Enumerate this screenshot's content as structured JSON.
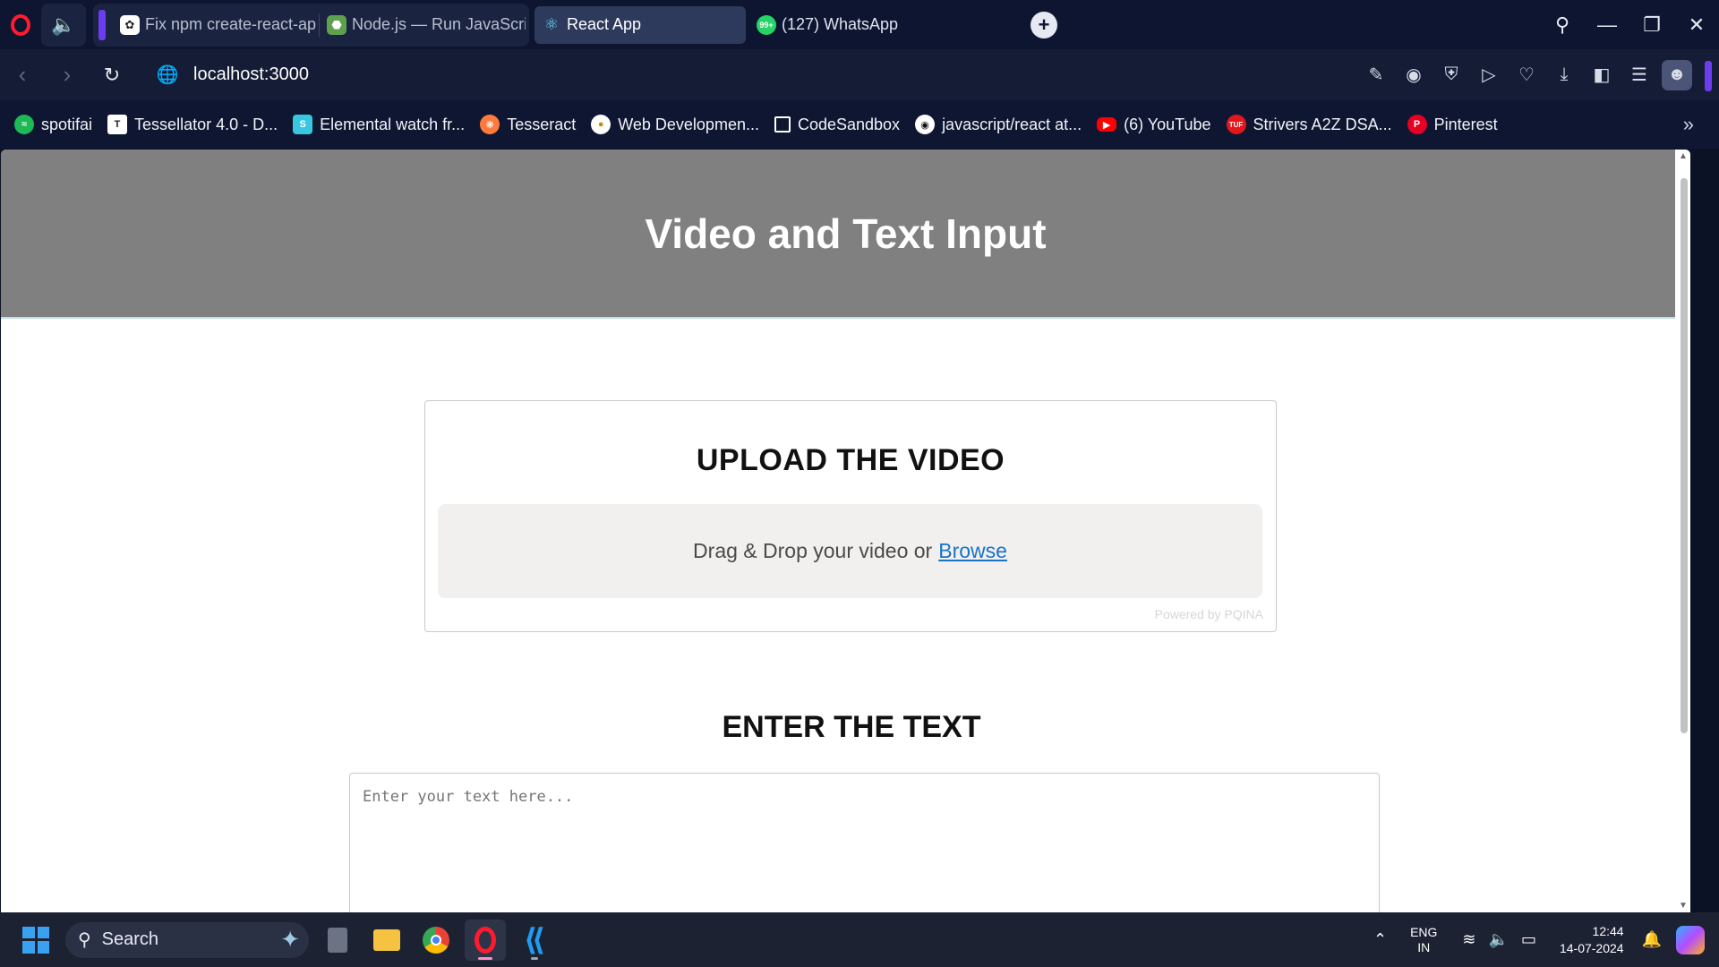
{
  "browser": {
    "tabs": [
      {
        "label": "Fix npm create-react-ap",
        "icon": "chatgpt-icon",
        "state": "inactive"
      },
      {
        "label": "Node.js — Run JavaScrip",
        "icon": "nodejs-icon",
        "state": "inactive"
      },
      {
        "label": "React App",
        "icon": "react-icon",
        "state": "active"
      },
      {
        "label": "(127) WhatsApp",
        "icon": "whatsapp-icon",
        "badge": "99+",
        "state": "inactive"
      }
    ],
    "address": "localhost:3000",
    "bookmarks": [
      {
        "label": "spotifai",
        "color": "#1db954"
      },
      {
        "label": "Tessellator 4.0 - D...",
        "color": "#ffffff"
      },
      {
        "label": "Elemental watch fr...",
        "color": "#39c6e0"
      },
      {
        "label": "Tesseract",
        "color": "#ff7a3c"
      },
      {
        "label": "Web Developmen...",
        "color": "#f5c400"
      },
      {
        "label": "CodeSandbox",
        "color": "#ffffff"
      },
      {
        "label": "javascript/react at...",
        "color": "#ffffff"
      },
      {
        "label": "(6) YouTube",
        "color": "#ff0000"
      },
      {
        "label": "Strivers A2Z DSA...",
        "color": "#e3161b"
      },
      {
        "label": "Pinterest",
        "color": "#e60023"
      }
    ]
  },
  "page": {
    "header_title": "Video and Text Input",
    "upload_title": "UPLOAD THE VIDEO",
    "dropzone_text": "Drag & Drop your video or",
    "browse_label": "Browse",
    "powered_by": "Powered by PQINA",
    "text_title": "ENTER THE TEXT",
    "text_placeholder": "Enter your text here..."
  },
  "taskbar": {
    "search_placeholder": "Search",
    "language": "ENG",
    "region": "IN",
    "time": "12:44",
    "date": "14-07-2024"
  }
}
